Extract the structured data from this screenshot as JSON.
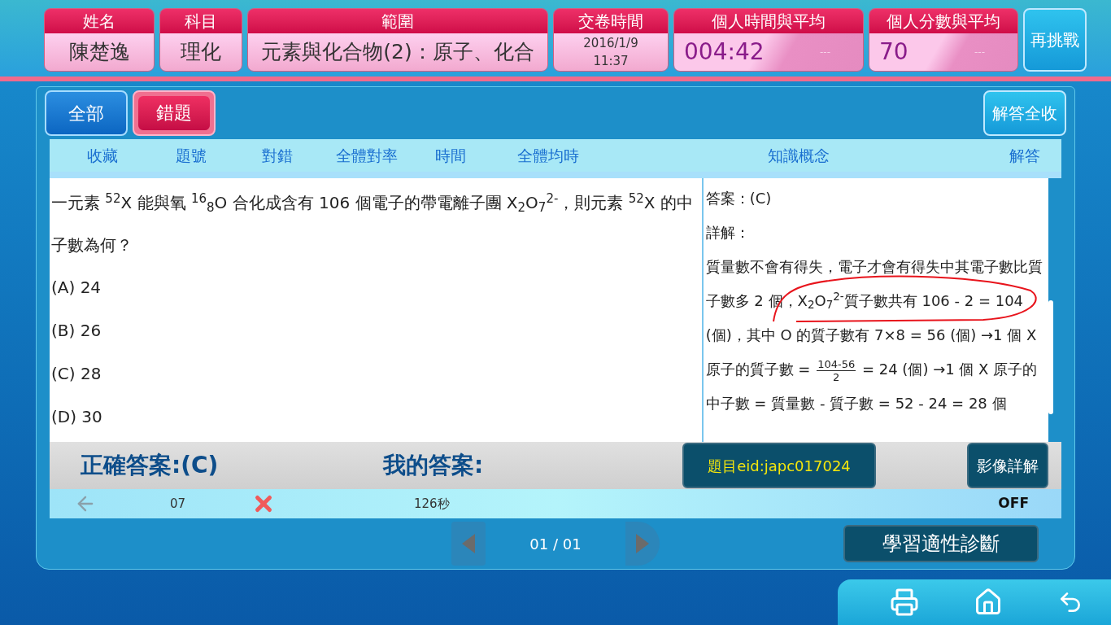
{
  "header": {
    "cards": [
      {
        "label": "姓名",
        "value": "陳楚逸",
        "kind": "text"
      },
      {
        "label": "科目",
        "value": "理化",
        "kind": "text"
      },
      {
        "label": "範圍",
        "value": "元素與化合物(2)：原子、化合",
        "kind": "text"
      },
      {
        "label": "交卷時間",
        "value": "2016/1/9",
        "value2": "11:37",
        "kind": "date"
      },
      {
        "label": "個人時間與平均",
        "value": "004:42",
        "average": "---",
        "kind": "compare"
      },
      {
        "label": "個人分數與平均",
        "value": "70",
        "average": "---",
        "kind": "compare"
      }
    ],
    "retry_button": "再挑戰"
  },
  "filters": [
    {
      "label": "全部",
      "selected": false
    },
    {
      "label": "錯題",
      "selected": true
    }
  ],
  "collapse_button": "解答全收",
  "columns": [
    "收藏",
    "題號",
    "對錯",
    "全體對率",
    "時間",
    "全體均時",
    "知識概念",
    "解答"
  ],
  "question": {
    "stem": "一元素 $^{52}$X 能與氧 $^{16}$$_{8}$O 合化成含有 106 個電子的帶電離子團 X$_{2}$O$_{7}$$^{2-}$，則元素 $^{52}$X 的中子數為何？",
    "options": [
      "(A) 24",
      "(B) 26",
      "(C) 28",
      "(D) 30"
    ]
  },
  "solution": {
    "answer": "答案：(C)",
    "detail_label": "詳解：",
    "before_fraction": "質量數不會有得失，電子才會有得失中其電子數比質子數多 2 個，X$_{2}$O$_{7}$$^{2-}$質子數共有 106 - 2 = 104 (個)，其中 O 的質子數有 7×8 = 56 (個) →1 個 X 原子的質子數 = ",
    "numerator": "104-56",
    "denominator": "2",
    "after_fraction": " = 24 (個) →1 個 X 原子的中子數 = 質量數 - 質子數 = 52 - 24 = 28 個"
  },
  "answer_bar": {
    "correct": "正確答案:(C)",
    "mine": "我的答案:",
    "eid_button": "題目eid:japc017024",
    "video_button": "影像詳解"
  },
  "row": {
    "number": "07",
    "correct": false,
    "time": "126秒",
    "state": "OFF"
  },
  "pager": "01 / 01",
  "diagnosis_button": "學習適性診斷"
}
